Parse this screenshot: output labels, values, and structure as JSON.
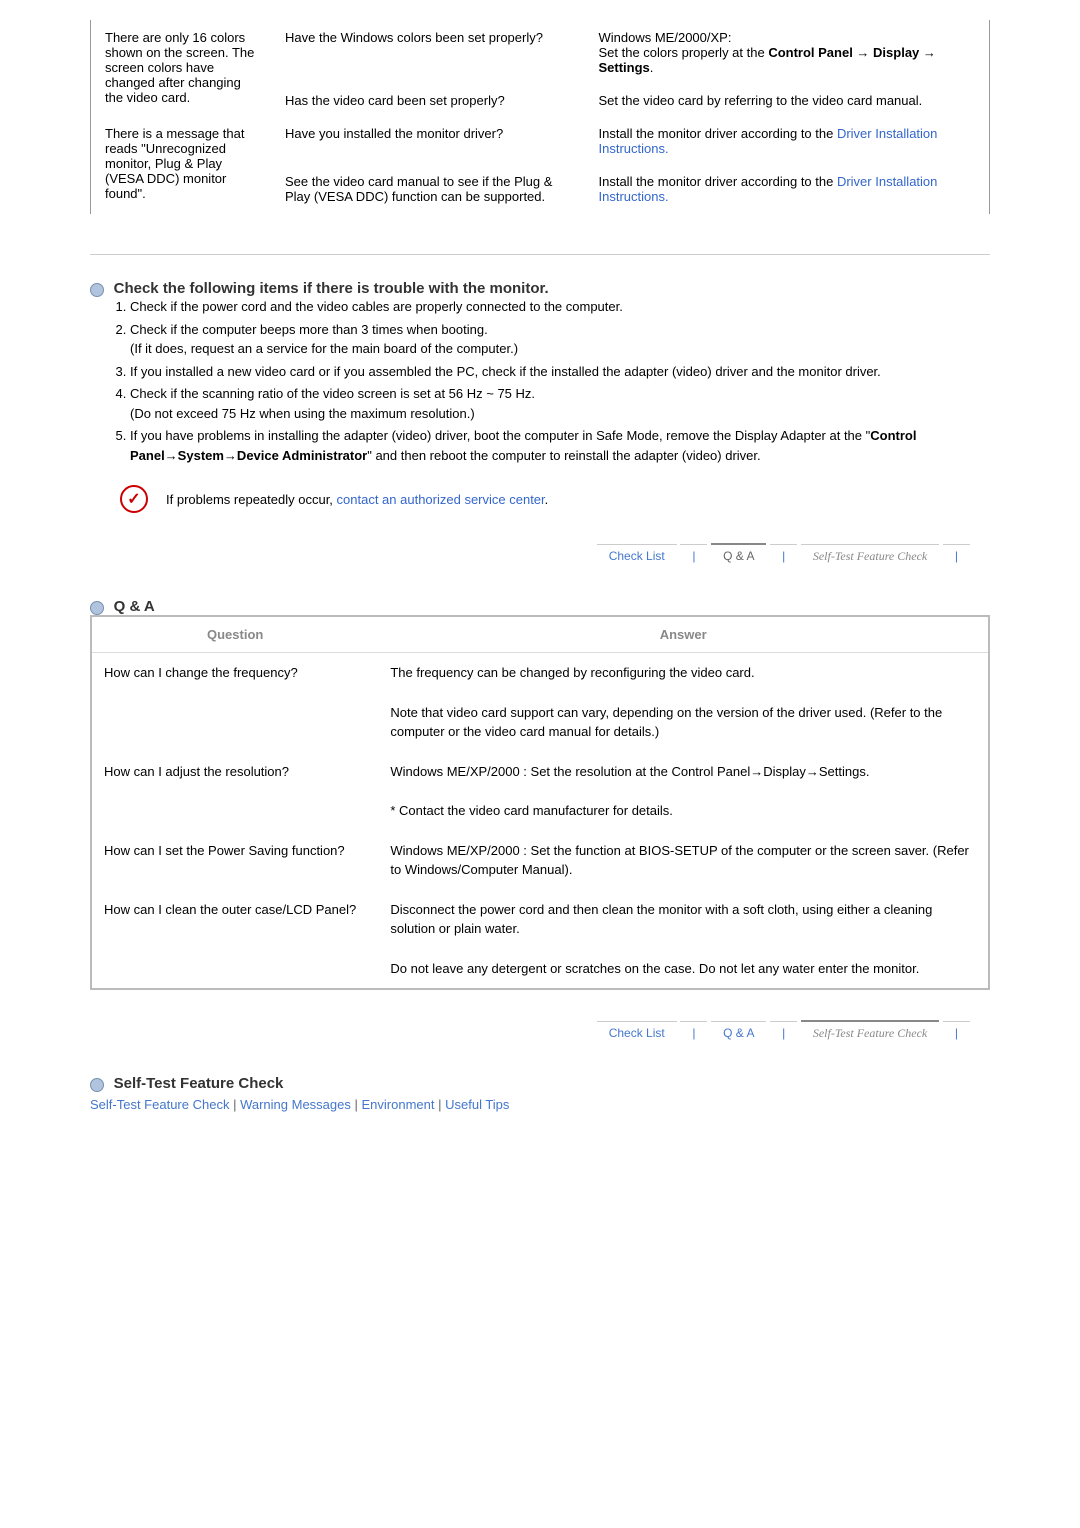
{
  "trouble": [
    {
      "symptom": "There are only 16 colors shown on the screen.\nThe screen colors have changed after changing the video card.",
      "rows": [
        {
          "checklist": "Have the Windows colors been set properly?",
          "solution_pre": "Windows ME/2000/XP:\nSet the colors properly at the ",
          "solution_bold": "Control Panel → Display → Settings",
          "solution_post": "."
        },
        {
          "checklist": "Has the video card been set properly?",
          "solution_pre": "Set the video card by referring to the video card manual.",
          "solution_bold": "",
          "solution_post": ""
        }
      ]
    },
    {
      "symptom": "There is a message that reads \"Unrecognized monitor, Plug & Play (VESA DDC) monitor found\".",
      "rows": [
        {
          "checklist": "Have you installed the monitor driver?",
          "solution_pre": "Install the monitor driver according to the ",
          "link": "Driver Installation Instructions."
        },
        {
          "checklist": "See the video card manual to see if the Plug & Play (VESA DDC) function can be supported.",
          "solution_pre": "Install the monitor driver according to the ",
          "link": "Driver Installation Instructions."
        }
      ]
    }
  ],
  "check_section": {
    "heading": "Check the following items if there is trouble with the monitor.",
    "items": [
      "Check if the power cord and the video cables are properly connected to the computer.",
      "Check if the computer beeps more than 3 times when booting.\n(If it does, request an a service for the main board of the computer.)",
      "If you installed a new video card or if you assembled the PC, check if the installed the adapter (video) driver and the monitor driver.",
      "Check if the scanning ratio of the video screen is set at 56 Hz ~ 75 Hz.\n(Do not exceed 75 Hz when using the maximum resolution.)",
      "If you have problems in installing the adapter (video) driver, boot the computer in Safe Mode, remove the Display Adapter at the \"Control Panel→System→Device Administrator\" and then reboot the computer to reinstall the adapter (video) driver."
    ],
    "note_pre": "If problems repeatedly occur, ",
    "note_link": "contact an authorized service center",
    "note_post": "."
  },
  "nav": {
    "check": "Check List",
    "qa": "Q & A",
    "self": "Self-Test Feature Check"
  },
  "qa": {
    "heading": "Q & A",
    "th_q": "Question",
    "th_a": "Answer",
    "rows": [
      {
        "q": "How can I change the frequency?",
        "a1": "The frequency can be changed by reconfiguring the video card.",
        "a2": "Note that video card support can vary, depending on the version of the driver used. (Refer to the computer or the video card manual for details.)"
      },
      {
        "q": "How can I adjust the resolution?",
        "a1": "Windows ME/XP/2000 : Set the resolution at the Control Panel→Display→Settings.",
        "a2": "* Contact the video card manufacturer for details."
      },
      {
        "q": "How can I set the Power Saving function?",
        "a1": "Windows ME/XP/2000 : Set the function at BIOS-SETUP of the computer or the screen saver. (Refer to Windows/Computer Manual).",
        "a2": ""
      },
      {
        "q": "How can I clean the outer case/LCD Panel?",
        "a1": "Disconnect the power cord and then clean the monitor with a soft cloth, using either a cleaning solution or plain water.",
        "a2": "Do not leave any detergent or scratches on the case. Do not let any water enter the monitor."
      }
    ]
  },
  "selftest": {
    "heading": "Self-Test Feature Check",
    "links": [
      "Self-Test Feature Check",
      "Warning Messages",
      "Environment",
      "Useful Tips"
    ]
  }
}
